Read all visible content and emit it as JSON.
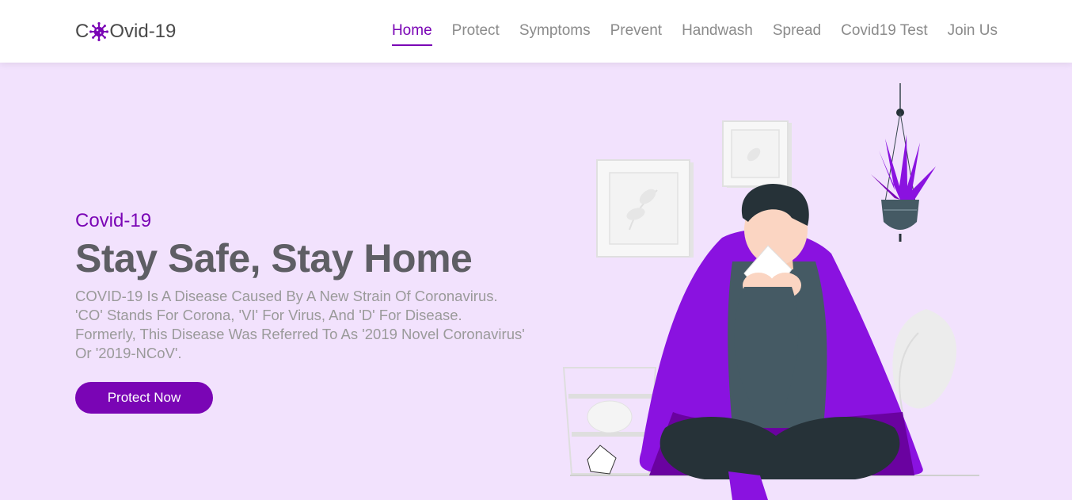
{
  "brand": {
    "prefix": "C",
    "suffix": "Ovid-19",
    "accent": "#7a05b5"
  },
  "nav": {
    "items": [
      {
        "label": "Home",
        "active": true
      },
      {
        "label": "Protect",
        "active": false
      },
      {
        "label": "Symptoms",
        "active": false
      },
      {
        "label": "Prevent",
        "active": false
      },
      {
        "label": "Handwash",
        "active": false
      },
      {
        "label": "Spread",
        "active": false
      },
      {
        "label": "Covid19 Test",
        "active": false
      },
      {
        "label": "Join Us",
        "active": false
      }
    ]
  },
  "hero": {
    "eyebrow": "Covid-19",
    "headline": "Stay Safe, Stay Home",
    "description": "COVID-19 Is A Disease Caused By A New Strain Of Coronavirus. 'CO' Stands For Corona, 'VI' For Virus, And 'D' For Disease. Formerly, This Disease Was Referred To As '2019 Novel Coronavirus' Or '2019-NCoV'.",
    "cta_label": "Protect Now"
  },
  "colors": {
    "accent": "#7a05b5",
    "hero_bg": "#f2e2fd",
    "heading": "#5e5e64",
    "body_text": "#9a9a9a"
  },
  "icons": {
    "brand_virus": "virus-icon"
  }
}
